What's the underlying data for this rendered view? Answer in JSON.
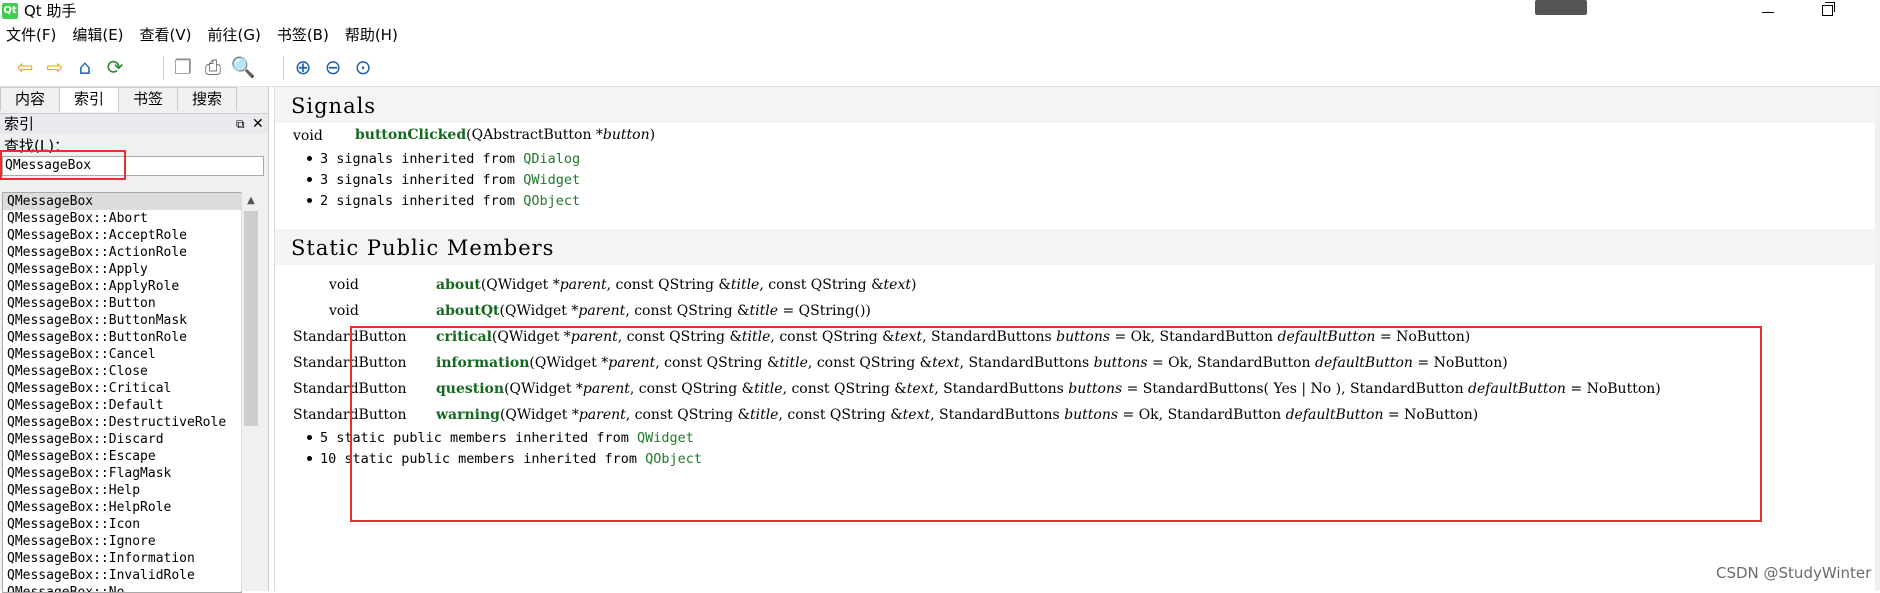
{
  "window": {
    "icon_text": "Qt",
    "title": "Qt 助手"
  },
  "menubar": [
    "文件(F)",
    "编辑(E)",
    "查看(V)",
    "前往(G)",
    "书签(B)",
    "帮助(H)"
  ],
  "toolbar": {
    "buttons": [
      {
        "name": "back-icon",
        "glyph": "⇦",
        "color": "#e8a317"
      },
      {
        "name": "forward-icon",
        "glyph": "⇨",
        "color": "#e8a317"
      },
      {
        "name": "home-icon",
        "glyph": "⌂",
        "color": "#2b6cb0"
      },
      {
        "name": "sync-icon",
        "glyph": "⟳",
        "color": "#2e8b2e"
      },
      {
        "name": "copy-icon",
        "glyph": "❐",
        "color": "#8c8c8c"
      },
      {
        "name": "print-icon",
        "glyph": "⎙",
        "color": "#6b6b6b"
      },
      {
        "name": "find-icon",
        "glyph": "🔍",
        "color": "#8a6d3b"
      },
      {
        "name": "zoom-in-icon",
        "glyph": "⊕",
        "color": "#1d5fa8"
      },
      {
        "name": "zoom-out-icon",
        "glyph": "⊖",
        "color": "#1d5fa8"
      },
      {
        "name": "reset-zoom-icon",
        "glyph": "⊙",
        "color": "#1d5fa8"
      }
    ]
  },
  "sidebar": {
    "tabs": [
      "内容",
      "索引",
      "书签",
      "搜索"
    ],
    "active_tab": 1,
    "panel_title": "索引",
    "find_label": "查找(L)：",
    "find_value": "QMessageBox",
    "items": [
      "QMessageBox",
      "QMessageBox::Abort",
      "QMessageBox::AcceptRole",
      "QMessageBox::ActionRole",
      "QMessageBox::Apply",
      "QMessageBox::ApplyRole",
      "QMessageBox::Button",
      "QMessageBox::ButtonMask",
      "QMessageBox::ButtonRole",
      "QMessageBox::Cancel",
      "QMessageBox::Close",
      "QMessageBox::Critical",
      "QMessageBox::Default",
      "QMessageBox::DestructiveRole",
      "QMessageBox::Discard",
      "QMessageBox::Escape",
      "QMessageBox::FlagMask",
      "QMessageBox::Help",
      "QMessageBox::HelpRole",
      "QMessageBox::Icon",
      "QMessageBox::Ignore",
      "QMessageBox::Information",
      "QMessageBox::InvalidRole",
      "QMessageBox::No"
    ]
  },
  "content": {
    "signals_title": "Signals",
    "signal_row": {
      "ret": "void",
      "name": "buttonClicked",
      "open": "(QAbstractButton *",
      "param": "button",
      "close": ")"
    },
    "signal_inherits": [
      {
        "text": "3 signals inherited from ",
        "link": "QDialog"
      },
      {
        "text": "3 signals inherited from ",
        "link": "QWidget"
      },
      {
        "text": "2 signals inherited from ",
        "link": "QObject"
      }
    ],
    "static_title": "Static Public Members",
    "static_rows": [
      {
        "ret": "void",
        "name": "about",
        "parts": [
          [
            "(QWidget *",
            0
          ],
          [
            "parent",
            1
          ],
          [
            ",  const QString &",
            0
          ],
          [
            "title",
            1
          ],
          [
            ",  const QString &",
            0
          ],
          [
            "text",
            1
          ],
          [
            ")",
            0
          ]
        ]
      },
      {
        "ret": "void",
        "name": "aboutQt",
        "parts": [
          [
            "(QWidget *",
            0
          ],
          [
            "parent",
            1
          ],
          [
            ",  const QString &",
            0
          ],
          [
            "title",
            1
          ],
          [
            " = QString())",
            0
          ]
        ]
      },
      {
        "ret": "StandardButton",
        "name": "critical",
        "parts": [
          [
            "(QWidget *",
            0
          ],
          [
            "parent",
            1
          ],
          [
            ",  const QString &",
            0
          ],
          [
            "title",
            1
          ],
          [
            ",  const QString &",
            0
          ],
          [
            "text",
            1
          ],
          [
            ",  StandardButtons ",
            0
          ],
          [
            "buttons",
            1
          ],
          [
            " = Ok,  StandardButton ",
            0
          ],
          [
            "defaultButton",
            1
          ],
          [
            " = NoButton)",
            0
          ]
        ]
      },
      {
        "ret": "StandardButton",
        "name": "information",
        "parts": [
          [
            "(QWidget *",
            0
          ],
          [
            "parent",
            1
          ],
          [
            ",  const QString &",
            0
          ],
          [
            "title",
            1
          ],
          [
            ",  const QString &",
            0
          ],
          [
            "text",
            1
          ],
          [
            ",  StandardButtons ",
            0
          ],
          [
            "buttons",
            1
          ],
          [
            " = Ok,  StandardButton ",
            0
          ],
          [
            "defaultButton",
            1
          ],
          [
            " = NoButton)",
            0
          ]
        ]
      },
      {
        "ret": "StandardButton",
        "name": "question",
        "parts": [
          [
            "(QWidget *",
            0
          ],
          [
            "parent",
            1
          ],
          [
            ",  const QString &",
            0
          ],
          [
            "title",
            1
          ],
          [
            ",  const QString &",
            0
          ],
          [
            "text",
            1
          ],
          [
            ",  StandardButtons ",
            0
          ],
          [
            "buttons",
            1
          ],
          [
            " = StandardButtons( Yes | No ),  StandardButton ",
            0
          ],
          [
            "defaultButton",
            1
          ],
          [
            " = NoButton)",
            0
          ]
        ]
      },
      {
        "ret": "StandardButton",
        "name": "warning",
        "parts": [
          [
            "(QWidget *",
            0
          ],
          [
            "parent",
            1
          ],
          [
            ",  const QString &",
            0
          ],
          [
            "title",
            1
          ],
          [
            ",  const QString &",
            0
          ],
          [
            "text",
            1
          ],
          [
            ",  StandardButtons ",
            0
          ],
          [
            "buttons",
            1
          ],
          [
            " = Ok,  StandardButton ",
            0
          ],
          [
            "defaultButton",
            1
          ],
          [
            " = NoButton)",
            0
          ]
        ]
      }
    ],
    "static_inherits": [
      {
        "text": "5 static public members inherited from ",
        "link": "QWidget"
      },
      {
        "text": "10 static public members inherited from ",
        "link": "QObject"
      }
    ]
  },
  "watermark": "CSDN @StudyWinter",
  "colors": {
    "link": "#217a27",
    "function": "#15691f",
    "highlight_box": "#e82e2e"
  }
}
